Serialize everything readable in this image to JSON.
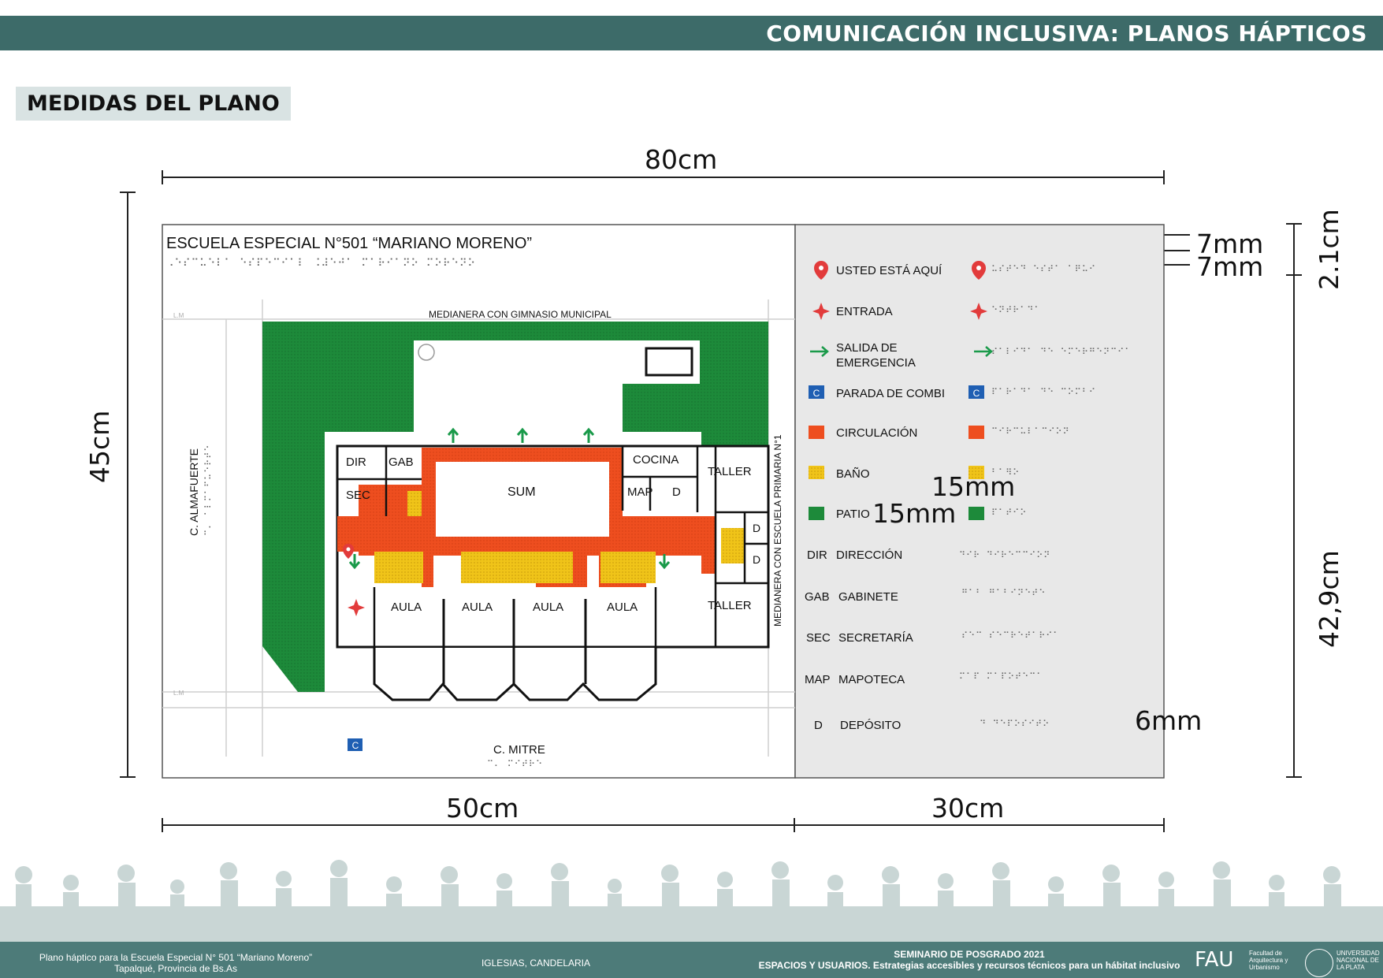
{
  "header": {
    "title": "COMUNICACIÓN INCLUSIVA: PLANOS HÁPTICOS"
  },
  "section": {
    "title": "MEDIDAS DEL PLANO"
  },
  "dimensions": {
    "width_total": "80cm",
    "height_total": "45cm",
    "width_left": "50cm",
    "width_right": "30cm",
    "top_margin_a": "7mm",
    "top_margin_b": "7mm",
    "top_total": "2.1cm",
    "height_rest": "42,9cm",
    "icon_gap_h": "15mm",
    "icon_gap_v": "15mm",
    "row_gap": "6mm"
  },
  "plan": {
    "title": "ESCUELA ESPECIAL N°501 “MARIANO MORENO”",
    "title_braille": "⠠⠑⠎⠉⠥⠑⠇⠁ ⠑⠎⠏⠑⠉⠊⠁⠇ ⠨⠼⠑⠚⠁ ⠍⠁⠗⠊⠁⠝⠕ ⠍⠕⠗⠑⠝⠕",
    "medianera_top": "MEDIANERA CON GIMNASIO MUNICIPAL",
    "medianera_side": "MEDIANERA CON ESCUELA PRIMARIA N°1",
    "street_left": "C. ALMAFUERTE",
    "street_left_braille": "⠉⠄ ⠁⠇⠍⠁⠋⠥⠑⠗⠞⠑",
    "street_bottom": "C. MITRE",
    "street_bottom_braille": "⠉⠄ ⠍⠊⠞⠗⠑",
    "lm": "L.M",
    "rooms": {
      "dir": "DIR",
      "gab": "GAB",
      "sec": "SEC",
      "sum": "SUM",
      "cocina": "COCINA",
      "map": "MAP",
      "d": "D",
      "taller": "TALLER",
      "aula": "AULA",
      "c": "C"
    },
    "room_braille": "⠠⠠⠭⠭",
    "colors": {
      "patio": "#1d8a3a",
      "circulacion": "#ee4e1f",
      "bano": "#f0c419",
      "combi": "#1f5fb3",
      "marker": "#e23b3b",
      "exit": "#1a9a4a"
    }
  },
  "legend": {
    "items": [
      {
        "icon": "location-pin-icon",
        "label": "USTED ESTÁ AQUÍ",
        "braille": "⠥⠎⠞⠑⠙ ⠑⠎⠞⠁ ⠁⠟⠥⠊"
      },
      {
        "icon": "entrance-star-icon",
        "label": "ENTRADA",
        "braille": "⠑⠝⠞⠗⠁⠙⠁"
      },
      {
        "icon": "exit-arrow-icon",
        "label": "SALIDA DE",
        "label2": "EMERGENCIA",
        "braille": "⠎⠁⠇⠊⠙⠁ ⠙⠑ ⠑⠍⠑⠗⠛⠑⠝⠉⠊⠁"
      },
      {
        "icon": "combi-stop-icon",
        "label": "PARADA DE COMBI",
        "braille": "⠏⠁⠗⠁⠙⠁ ⠙⠑ ⠉⠕⠍⠃⠊"
      },
      {
        "icon": "circulation-swatch-icon",
        "label": "CIRCULACIÓN",
        "braille": "⠉⠊⠗⠉⠥⠇⠁⠉⠊⠕⠝"
      },
      {
        "icon": "bathroom-swatch-icon",
        "label": "BAÑO",
        "braille": "⠃⠁⠻⠕"
      },
      {
        "icon": "patio-swatch-icon",
        "label": "PATIO",
        "braille": "⠏⠁⠞⠊⠕"
      }
    ],
    "abbr": [
      {
        "code": "DIR",
        "label": "DIRECCIÓN",
        "braille": "⠙⠊⠗ ⠙⠊⠗⠑⠉⠉⠊⠕⠝"
      },
      {
        "code": "GAB",
        "label": "GABINETE",
        "braille": "⠛⠁⠃ ⠛⠁⠃⠊⠝⠑⠞⠑"
      },
      {
        "code": "SEC",
        "label": "SECRETARÍA",
        "braille": "⠎⠑⠉ ⠎⠑⠉⠗⠑⠞⠁⠗⠊⠁"
      },
      {
        "code": "MAP",
        "label": "MAPOTECA",
        "braille": "⠍⠁⠏ ⠍⠁⠏⠕⠞⠑⠉⠁"
      },
      {
        "code": "D",
        "label": "DEPÓSITO",
        "braille": "⠙ ⠙⠑⠏⠕⠎⠊⠞⠕"
      }
    ]
  },
  "footer": {
    "left_line1": "Plano háptico para la Escuela Especial N° 501 “Mariano Moreno”",
    "left_line2": "Tapalqué, Provincia de Bs.As",
    "center": "IGLESIAS, CANDELARIA",
    "seminar_line1": "SEMINARIO DE POSGRADO 2021",
    "seminar_line2": "ESPACIOS Y USUARIOS. Estrategias accesibles y recursos técnicos para un hábitat inclusivo",
    "fau_logo": "FAU",
    "fau_text": "Facultad de Arquitectura y Urbanismo",
    "unlp_text": "UNIVERSIDAD NACIONAL DE LA PLATA"
  }
}
